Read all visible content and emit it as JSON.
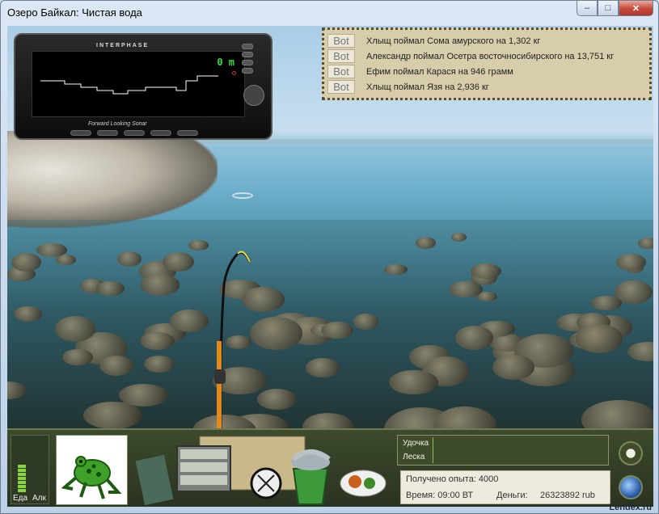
{
  "window": {
    "title": "Озеро Байкал: Чистая вода",
    "min_glyph": "–",
    "max_glyph": "□",
    "close_glyph": "✕"
  },
  "sonar": {
    "brand": "INTERPHASE",
    "depth": "0 m",
    "caption": "Forward Looking Sonar"
  },
  "chat": [
    {
      "tag": "Bot",
      "text": "Хлыщ поймал Сома амурского на 1,302 кг"
    },
    {
      "tag": "Bot",
      "text": "Александр поймал Осетра восточносибирского на 13,751 кг"
    },
    {
      "tag": "Bot",
      "text": "Ефим поймал Карася на 946 грамм"
    },
    {
      "tag": "Bot",
      "text": "Хлыщ поймал Язя на 2,936 кг"
    }
  ],
  "gauges": {
    "food_label": "Еда",
    "alcohol_label": "Алк",
    "food_level": 0.6,
    "alcohol_level": 0.0
  },
  "status": {
    "rod_label": "Удочка",
    "line_label": "Леска"
  },
  "info": {
    "experience": "Получено опыта: 4000",
    "time_label": "Время: 09:00 ВТ",
    "money_label": "Деньги:",
    "money_value": "26323892 rub"
  },
  "watermark": "Lendex.ru",
  "icons": {
    "frog": "frog-icon",
    "tackle": "tackle-box-icon",
    "compass": "compass-icon",
    "bucket": "fish-bucket-icon",
    "food": "food-plate-icon",
    "menu": "menu-icon",
    "globe": "globe-icon"
  }
}
